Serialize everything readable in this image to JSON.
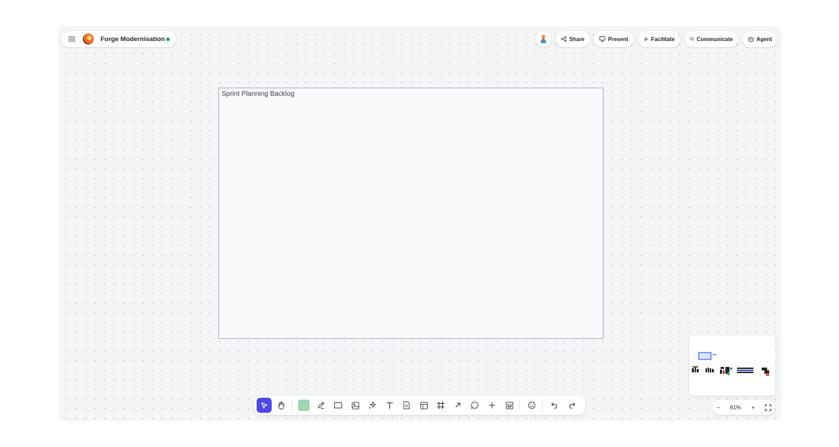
{
  "header": {
    "doc_title": "Forge Modernisation",
    "status_color": "#1aa24b",
    "menu_icon": "hamburger-icon",
    "logo_icon": "flame-logo-icon"
  },
  "actions": [
    {
      "label": "Share",
      "icon": "share-icon"
    },
    {
      "label": "Present",
      "icon": "monitor-icon"
    },
    {
      "label": "Facilitate",
      "icon": "sparkles-icon"
    },
    {
      "label": "Communicate",
      "icon": "chat-icon"
    },
    {
      "label": "Agent",
      "icon": "robot-icon"
    }
  ],
  "frame": {
    "label": "Sprint Planning Backlog"
  },
  "zoom": {
    "level": "61%",
    "minus": "−",
    "plus": "+"
  },
  "toolbar": {
    "tools": [
      "select",
      "hand",
      "sticky-note",
      "pen",
      "rectangle",
      "image",
      "ai-sparkles",
      "text",
      "document",
      "table",
      "frame",
      "connector",
      "comment",
      "add",
      "templates",
      "reaction",
      "undo",
      "redo"
    ],
    "active_tool": "select",
    "accent": "#4f46e5",
    "sticky_color": "#9fd8b0"
  }
}
